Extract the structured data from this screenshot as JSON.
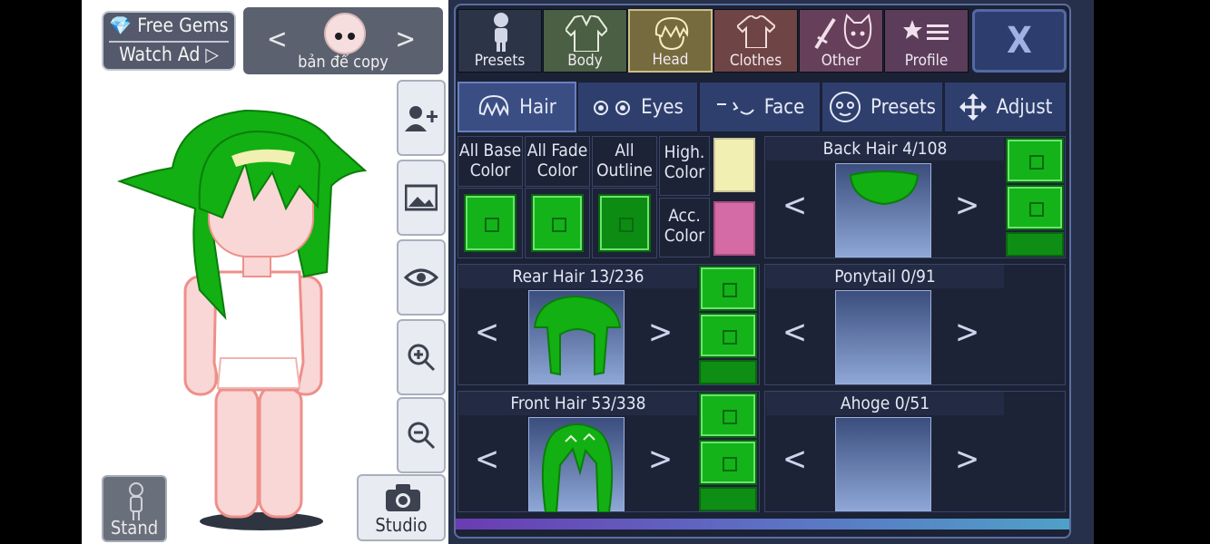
{
  "top_bar": {
    "free_gems": "Free Gems",
    "watch_ad": "Watch Ad ▷",
    "slot_label": "bản để copy"
  },
  "left_tools": {
    "stand_label": "Stand",
    "studio_label": "Studio"
  },
  "main_tabs": [
    {
      "label": "Presets"
    },
    {
      "label": "Body"
    },
    {
      "label": "Head"
    },
    {
      "label": "Clothes"
    },
    {
      "label": "Other"
    },
    {
      "label": "Profile"
    }
  ],
  "close_label": "X",
  "sub_tabs": [
    {
      "label": "Hair"
    },
    {
      "label": "Eyes"
    },
    {
      "label": "Face"
    },
    {
      "label": "Presets"
    },
    {
      "label": "Adjust"
    }
  ],
  "color_labels": {
    "all_base": "All Base Color",
    "all_fade": "All Fade Color",
    "all_outline": "All Outline",
    "high_color": "High. Color",
    "acc_color": "Acc. Color"
  },
  "parts": {
    "back_hair": "Back Hair 4/108",
    "rear_hair": "Rear Hair 13/236",
    "ponytail": "Ponytail 0/91",
    "front_hair": "Front Hair 53/338",
    "ahoge": "Ahoge 0/51"
  },
  "colors": {
    "hair_green": "#12b012",
    "highlight": "#f2efb2",
    "accessory": "#d46aa6",
    "active_tab": "#7a6a3a"
  }
}
